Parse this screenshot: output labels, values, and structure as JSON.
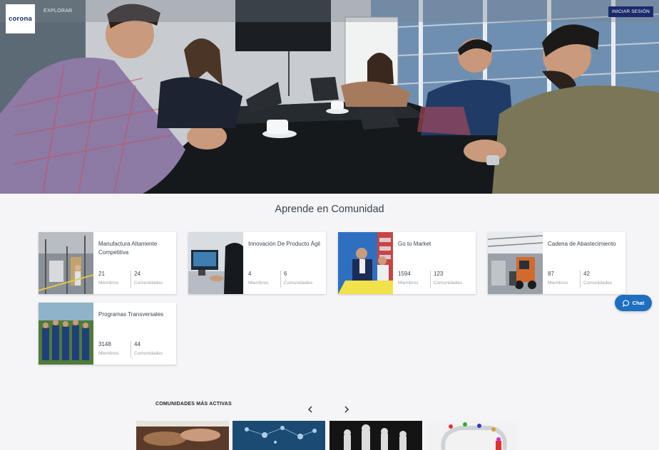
{
  "header": {
    "logo_text": "corona",
    "nav_explore": "EXPLORAR",
    "login_label": "INICIAR SESIÓN"
  },
  "main": {
    "section_title": "Aprende en Comunidad",
    "communities": [
      {
        "title": "Manufactura Altamente Competitiva",
        "members": "21",
        "members_label": "Miembros",
        "communities": "24",
        "communities_label": "Comunidades"
      },
      {
        "title": "Innovación De Producto Ágil",
        "members": "4",
        "members_label": "Miembros",
        "communities": "6",
        "communities_label": "Comunidades"
      },
      {
        "title": "Go to Market",
        "members": "1594",
        "members_label": "Miembros",
        "communities": "123",
        "communities_label": "Comunidades"
      },
      {
        "title": "Cadena de Abastecimiento",
        "members": "87",
        "members_label": "Miembros",
        "communities": "42",
        "communities_label": "Comunidades"
      },
      {
        "title": "Programas Transversales",
        "members": "3148",
        "members_label": "Miembros",
        "communities": "44",
        "communities_label": "Comunidades"
      }
    ]
  },
  "chat": {
    "label": "Chat"
  },
  "active": {
    "title": "COMUNIDADES MÁS ACTIVAS"
  },
  "colors": {
    "brand": "#1b2a6b",
    "chat": "#1e6fc0",
    "background": "#f5f5f7"
  },
  "icons": {
    "chat": "chat-bubble-icon",
    "prev": "chevron-left-icon",
    "next": "chevron-right-icon"
  }
}
